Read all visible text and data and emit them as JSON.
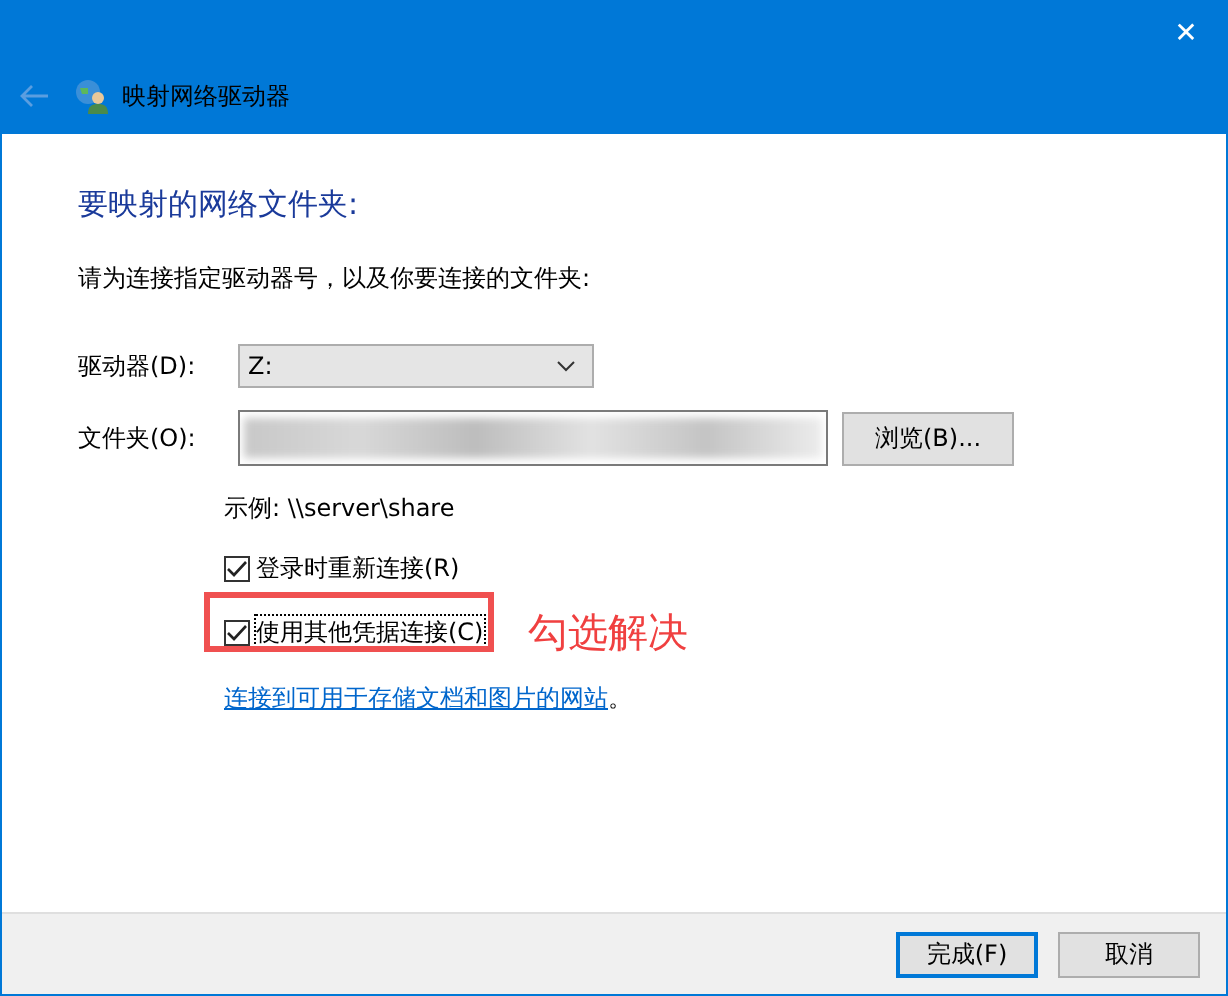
{
  "window": {
    "title": "映射网络驱动器",
    "close": "✕"
  },
  "heading": "要映射的网络文件夹:",
  "description": "请为连接指定驱动器号，以及你要连接的文件夹:",
  "drive": {
    "label": "驱动器(D):",
    "value": "Z:"
  },
  "folder": {
    "label": "文件夹(O):",
    "browse": "浏览(B)..."
  },
  "example": "示例: \\\\server\\share",
  "options": [
    {
      "label": "登录时重新连接(R)",
      "checked": true,
      "highlighted": false
    },
    {
      "label": "使用其他凭据连接(C)",
      "checked": true,
      "highlighted": true
    }
  ],
  "annotation": "勾选解决",
  "link": {
    "text": "连接到可用于存储文档和图片的网站",
    "suffix": "。"
  },
  "buttons": [
    {
      "label": "完成(F)",
      "default": true
    },
    {
      "label": "取消",
      "default": false
    }
  ]
}
